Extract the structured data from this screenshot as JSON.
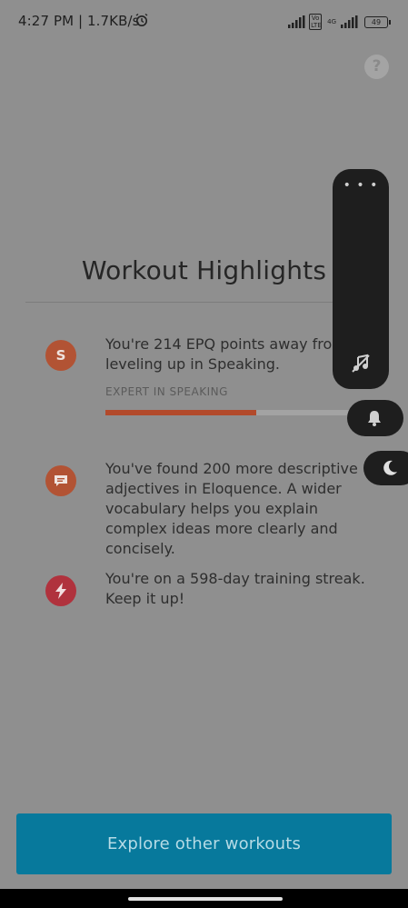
{
  "status_bar": {
    "time_speed": "4:27 PM | 1.7KB/s",
    "network_badge": "Vo LTE",
    "network_type": "4G",
    "battery": "49",
    "icons": [
      "alarm-icon",
      "signal-icon",
      "signal-icon",
      "battery-icon"
    ]
  },
  "header": {
    "help_label": "?",
    "title": "Workout Highlights"
  },
  "highlights": [
    {
      "icon_letter": "S",
      "text": "You're 214 EPQ points away from leveling up in Speaking.",
      "level_label": "EXPERT IN SPEAKING",
      "progress": 0.61,
      "icon": "speaking-badge-icon"
    },
    {
      "text": "You've found 200 more descriptive adjectives in Eloquence. A wider vocabulary helps you explain complex ideas more clearly and concisely.",
      "icon": "chat-bubble-icon"
    },
    {
      "text": "You're on a 598-day training streak. Keep it up!",
      "icon": "lightning-icon"
    }
  ],
  "floating_panel": {
    "more_label": "• • •",
    "icons": [
      "more-icon",
      "music-off-icon",
      "bell-icon",
      "moon-icon"
    ]
  },
  "cta": {
    "label": "Explore other workouts"
  },
  "colors": {
    "accent_orange": "#b24a2b",
    "accent_red": "#b0323d",
    "button_blue": "#07799c"
  }
}
